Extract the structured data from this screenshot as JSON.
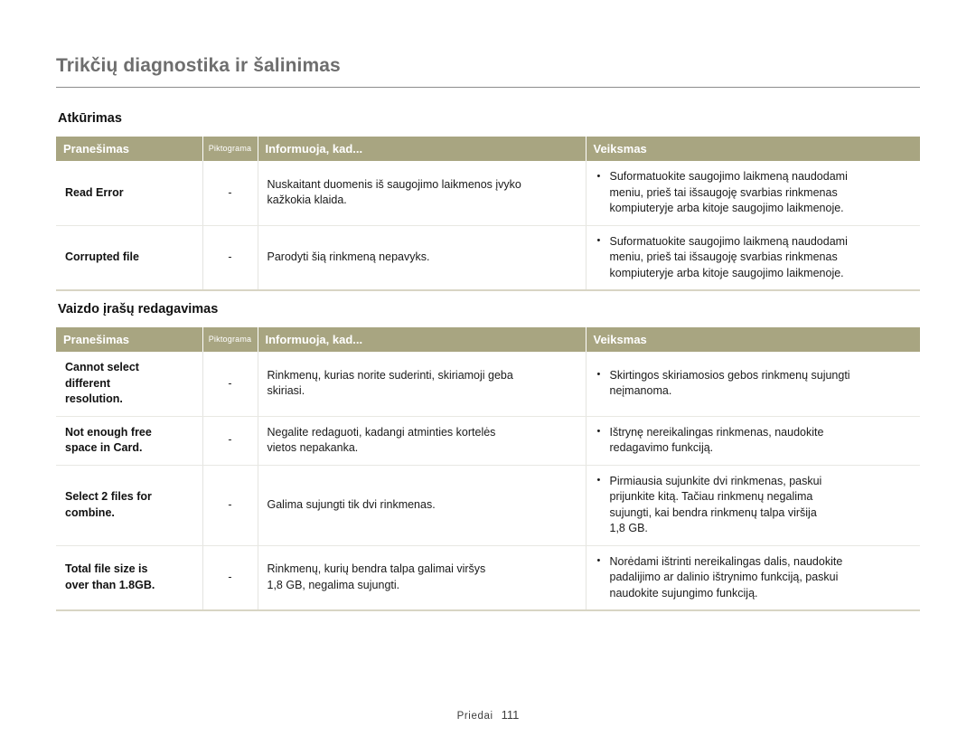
{
  "document": {
    "title": "Trikčių diagnostika ir šalinimas"
  },
  "columns": {
    "message": "Pranešimas",
    "icon": "Piktograma",
    "info": "Informuoja, kad...",
    "action": "Veiksmas"
  },
  "icon_placeholder": "-",
  "sections": [
    {
      "id": "recovery",
      "title": "Atkūrimas",
      "rows": [
        {
          "message_lines": [
            "Read Error"
          ],
          "icon": "-",
          "info_lines": [
            "Nuskaitant duomenis iš saugojimo laikmenos įvyko",
            "kažkokia klaida."
          ],
          "actions": [
            [
              "Suformatuokite saugojimo laikmeną naudodami",
              "meniu, prieš tai išsaugoję svarbias rinkmenas",
              "kompiuteryje arba kitoje saugojimo laikmenoje."
            ]
          ]
        },
        {
          "message_lines": [
            "Corrupted file"
          ],
          "icon": "-",
          "info_lines": [
            "Parodyti šią rinkmeną nepavyks."
          ],
          "actions": [
            [
              "Suformatuokite saugojimo laikmeną naudodami",
              "meniu, prieš tai išsaugoję svarbias rinkmenas",
              "kompiuteryje arba kitoje saugojimo laikmenoje."
            ]
          ]
        }
      ]
    },
    {
      "id": "video-edit",
      "title": "Vaizdo įrašų redagavimas",
      "rows": [
        {
          "message_lines": [
            "Cannot select",
            "different",
            "resolution."
          ],
          "icon": "-",
          "info_lines": [
            "Rinkmenų, kurias norite suderinti, skiriamoji geba",
            "skiriasi."
          ],
          "actions": [
            [
              "Skirtingos skiriamosios gebos rinkmenų sujungti",
              "neįmanoma."
            ]
          ]
        },
        {
          "message_lines": [
            "Not enough free",
            "space in Card."
          ],
          "icon": "-",
          "info_lines": [
            "Negalite redaguoti, kadangi atminties kortelės",
            "vietos nepakanka."
          ],
          "actions": [
            [
              "Ištrynę nereikalingas rinkmenas, naudokite",
              "redagavimo funkciją."
            ]
          ]
        },
        {
          "message_lines": [
            "Select 2 files for",
            "combine."
          ],
          "icon": "-",
          "info_lines": [
            "Galima sujungti tik dvi rinkmenas."
          ],
          "actions": [
            [
              "Pirmiausia sujunkite dvi rinkmenas, paskui",
              "prijunkite kitą. Tačiau rinkmenų negalima",
              "sujungti, kai bendra rinkmenų talpa viršija",
              "1,8 GB."
            ]
          ]
        },
        {
          "message_lines": [
            "Total file size is",
            "over than 1.8GB."
          ],
          "icon": "-",
          "info_lines": [
            "Rinkmenų, kurių bendra talpa galimai viršys",
            "1,8 GB, negalima sujungti."
          ],
          "actions": [
            [
              "Norėdami ištrinti nereikalingas dalis, naudokite",
              "padalijimo ar dalinio ištrynimo funkciją, paskui",
              "naudokite sujungimo funkciją."
            ]
          ]
        }
      ]
    }
  ],
  "footer": {
    "label": "Priedai",
    "page_number": "111"
  },
  "colors": {
    "header_band": "#a8a581",
    "title_text": "#6e6e6e",
    "table_bottom_rule": "#d8d5c4",
    "row_divider": "#e8e8e3"
  }
}
